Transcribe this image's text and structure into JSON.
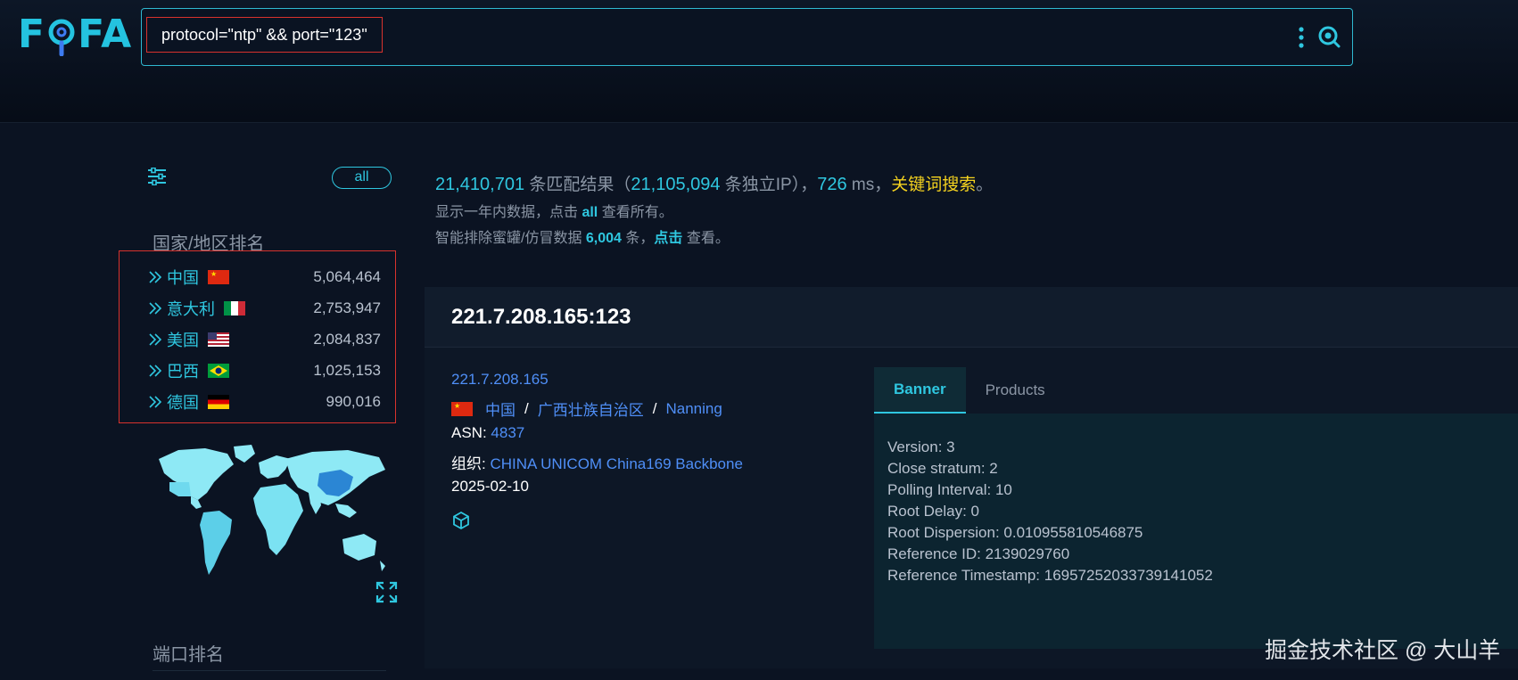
{
  "header": {
    "logo": {
      "letter_f": "F",
      "letter_fa": "FA"
    },
    "search": {
      "query": "protocol=\"ntp\" && port=\"123\""
    }
  },
  "sidebar": {
    "all_label": "all",
    "country_title": "国家/地区排名",
    "countries": [
      {
        "name": "中国",
        "count": "5,064,464",
        "flag": "china-flag"
      },
      {
        "name": "意大利",
        "count": "2,753,947",
        "flag": "italy-flag"
      },
      {
        "name": "美国",
        "count": "2,084,837",
        "flag": "usa-flag"
      },
      {
        "name": "巴西",
        "count": "1,025,153",
        "flag": "brazil-flag"
      },
      {
        "name": "德国",
        "count": "990,016",
        "flag": "germany-flag"
      }
    ],
    "port_title": "端口排名"
  },
  "summary": {
    "total": "21,410,701",
    "total_suffix": " 条匹配结果（",
    "unique_ip": "21,105,094",
    "unique_ip_suffix": " 条独立IP），",
    "ms": "726",
    "ms_suffix": " ms，",
    "keyword_link": "关键词搜索",
    "end": "。",
    "line2_prefix": "显示一年内数据，点击 ",
    "line2_link": "all",
    "line2_suffix": " 查看所有。",
    "line3_prefix": "智能排除蜜罐/仿冒数据 ",
    "line3_count": "6,004",
    "line3_mid": " 条，",
    "line3_link": "点击",
    "line3_suffix": " 查看。"
  },
  "result": {
    "host": "221.7.208.165:123",
    "ip": "221.7.208.165",
    "country": "中国",
    "region": "广西壮族自治区",
    "city": "Nanning",
    "geo_sep": "/",
    "asn_label": "ASN:",
    "asn": "4837",
    "org_label": "组织:",
    "org": "CHINA UNICOM China169 Backbone",
    "date": "2025-02-10",
    "tabs": [
      {
        "label": "Banner",
        "active": true
      },
      {
        "label": "Products",
        "active": false
      }
    ],
    "banner": [
      "Version: 3",
      "Close stratum: 2",
      "Polling Interval: 10",
      "Root Delay: 0",
      "Root Dispersion: 0.010955810546875",
      "Reference ID: 2139029760",
      "Reference Timestamp: 16957252033739141052"
    ]
  },
  "watermark": "掘金技术社区 @ 大山羊",
  "colors": {
    "accent": "#2fc7e0",
    "link": "#4f8ff7",
    "keyword": "#f4d21f",
    "highlight_box": "#d8322d",
    "background": "#0b1322"
  }
}
